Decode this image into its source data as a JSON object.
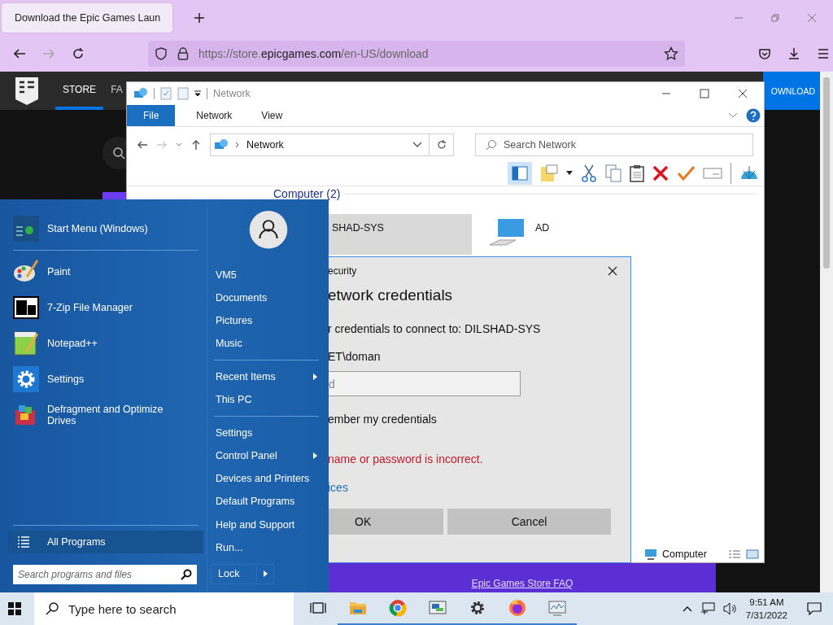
{
  "browser": {
    "tab_title": "Download the Epic Games Laun",
    "url_prefix": "https://store.",
    "url_domain": "epicgames.com",
    "url_path": "/en-US/download"
  },
  "store": {
    "nav": [
      {
        "label": "STORE",
        "selected": true
      },
      {
        "label": "FA",
        "selected": false
      }
    ],
    "download_button": "OWNLOAD",
    "faq_link": "Epic Games Store FAQ"
  },
  "explorer": {
    "title": "Network",
    "ribbon_tabs": [
      {
        "label": "File",
        "selected": true
      },
      {
        "label": "Network",
        "selected": false
      },
      {
        "label": "View",
        "selected": false
      }
    ],
    "address": "Network",
    "search_placeholder": "Search Network",
    "group": "Computer (2)",
    "items": [
      {
        "label": "SHAD-SYS",
        "selected": true
      },
      {
        "label": "AD",
        "selected": false
      }
    ],
    "status": "Computer"
  },
  "dialog": {
    "title": "ecurity",
    "heading": "etwork credentials",
    "prompt": "r credentials to connect to: DILSHAD-SYS",
    "user": "ET\\doman",
    "password_placeholder": "d",
    "remember": "ember my credentials",
    "error": "name or password is incorrect.",
    "link": "ices",
    "buttons": [
      "OK",
      "Cancel"
    ]
  },
  "start_menu": {
    "pinned": [
      {
        "label": "Start Menu (Windows)",
        "kind": "startmenu"
      },
      {
        "label": "Paint",
        "kind": "paint"
      },
      {
        "label": "7-Zip File Manager",
        "kind": "zip"
      },
      {
        "label": "Notepad++",
        "kind": "notepad"
      },
      {
        "label": "Settings",
        "kind": "settings"
      },
      {
        "label": "Defragment and Optimize Drives",
        "kind": "defrag"
      }
    ],
    "all_programs": "All Programs",
    "search_placeholder": "Search programs and files",
    "sections": [
      {
        "items": [
          {
            "label": "VM5",
            "submenu": false
          },
          {
            "label": "Documents",
            "submenu": false
          },
          {
            "label": "Pictures",
            "submenu": false
          },
          {
            "label": "Music",
            "submenu": false
          }
        ]
      },
      {
        "items": [
          {
            "label": "Recent Items",
            "submenu": true
          },
          {
            "label": "This PC",
            "submenu": false
          }
        ]
      },
      {
        "items": [
          {
            "label": "Settings",
            "submenu": false
          },
          {
            "label": "Control Panel",
            "submenu": true
          },
          {
            "label": "Devices and Printers",
            "submenu": false
          },
          {
            "label": "Default Programs",
            "submenu": false
          },
          {
            "label": "Help and Support",
            "submenu": false
          },
          {
            "label": "Run...",
            "submenu": false
          }
        ]
      }
    ],
    "lock": "Lock"
  },
  "taskbar": {
    "search_placeholder": "Type here to search",
    "apps": [
      {
        "kind": "taskview",
        "running": false
      },
      {
        "kind": "folder",
        "running": true
      },
      {
        "kind": "chrome",
        "running": true
      },
      {
        "kind": "display",
        "running": true
      },
      {
        "kind": "gear",
        "running": true
      },
      {
        "kind": "firefox",
        "running": true
      },
      {
        "kind": "monitor",
        "running": true
      }
    ],
    "time": "9:51 AM",
    "date": "7/31/2022"
  }
}
